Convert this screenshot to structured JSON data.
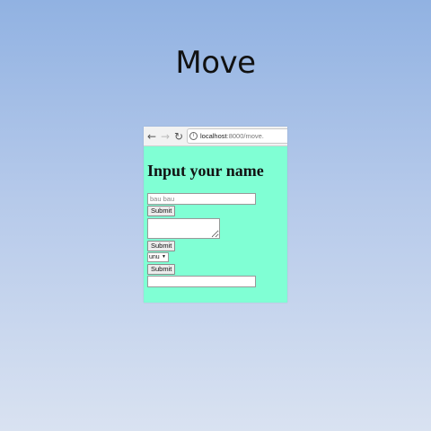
{
  "slide": {
    "title": "Move"
  },
  "browser": {
    "url_host": "localhost",
    "url_rest": ":8000/move."
  },
  "page": {
    "heading": "Input your name",
    "name_input": {
      "placeholder": "bau bau",
      "value": ""
    },
    "submit_label_1": "Submit",
    "submit_label_2": "Submit",
    "submit_label_3": "Submit",
    "select": {
      "selected": "unu"
    }
  }
}
